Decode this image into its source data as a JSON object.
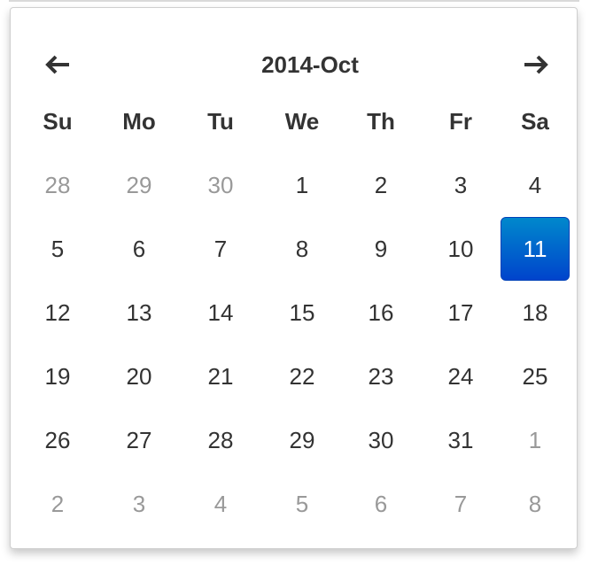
{
  "header": {
    "title": "2014-Oct",
    "prev_icon": "arrow-left-icon",
    "next_icon": "arrow-right-icon"
  },
  "weekdays": [
    "Su",
    "Mo",
    "Tu",
    "We",
    "Th",
    "Fr",
    "Sa"
  ],
  "days": [
    {
      "label": "28",
      "muted": true
    },
    {
      "label": "29",
      "muted": true
    },
    {
      "label": "30",
      "muted": true
    },
    {
      "label": "1"
    },
    {
      "label": "2"
    },
    {
      "label": "3"
    },
    {
      "label": "4"
    },
    {
      "label": "5"
    },
    {
      "label": "6"
    },
    {
      "label": "7"
    },
    {
      "label": "8"
    },
    {
      "label": "9"
    },
    {
      "label": "10"
    },
    {
      "label": "11",
      "selected": true
    },
    {
      "label": "12"
    },
    {
      "label": "13"
    },
    {
      "label": "14"
    },
    {
      "label": "15"
    },
    {
      "label": "16"
    },
    {
      "label": "17"
    },
    {
      "label": "18"
    },
    {
      "label": "19"
    },
    {
      "label": "20"
    },
    {
      "label": "21"
    },
    {
      "label": "22"
    },
    {
      "label": "23"
    },
    {
      "label": "24"
    },
    {
      "label": "25"
    },
    {
      "label": "26"
    },
    {
      "label": "27"
    },
    {
      "label": "28"
    },
    {
      "label": "29"
    },
    {
      "label": "30"
    },
    {
      "label": "31"
    },
    {
      "label": "1",
      "muted": true
    },
    {
      "label": "2",
      "muted": true
    },
    {
      "label": "3",
      "muted": true
    },
    {
      "label": "4",
      "muted": true
    },
    {
      "label": "5",
      "muted": true
    },
    {
      "label": "6",
      "muted": true
    },
    {
      "label": "7",
      "muted": true
    },
    {
      "label": "8",
      "muted": true
    }
  ],
  "colors": {
    "selected_top": "#0088cc",
    "selected_bottom": "#0044cc",
    "text": "#333333",
    "muted_text": "#999999"
  }
}
